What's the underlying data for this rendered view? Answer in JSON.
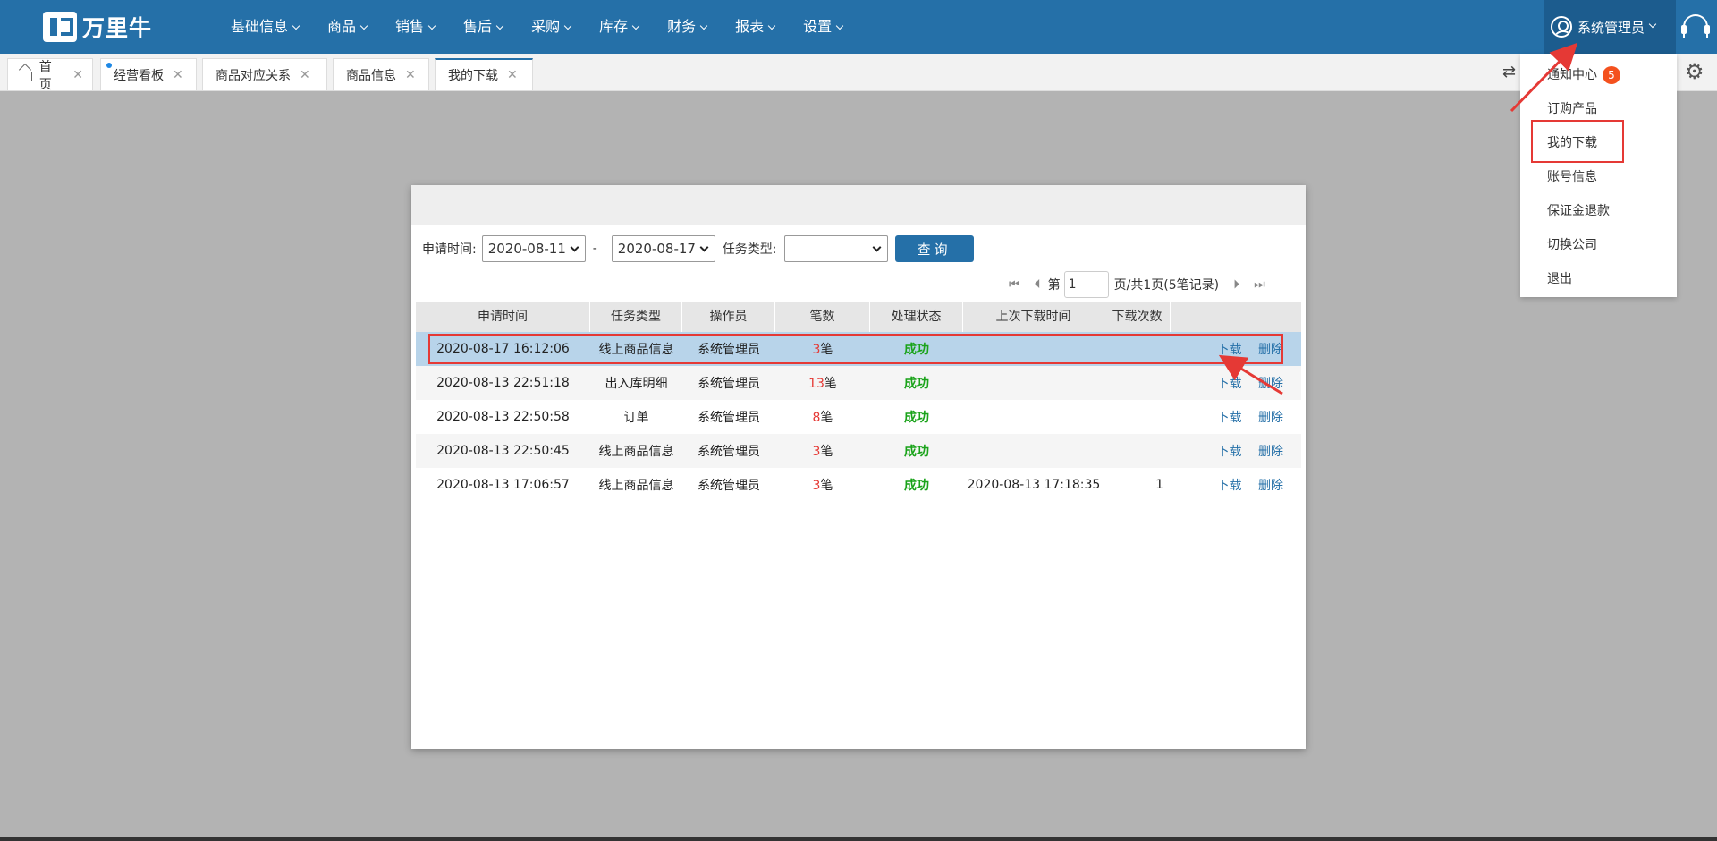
{
  "brand": {
    "name": "万里牛"
  },
  "nav": [
    "基础信息",
    "商品",
    "销售",
    "售后",
    "采购",
    "库存",
    "财务",
    "报表",
    "设置"
  ],
  "user": {
    "name": "系统管理员"
  },
  "tabs": [
    {
      "label": "首页"
    },
    {
      "label": "经营看板"
    },
    {
      "label": "商品对应关系"
    },
    {
      "label": "商品信息"
    },
    {
      "label": "我的下载"
    }
  ],
  "user_menu": {
    "items": [
      "通知中心",
      "订购产品",
      "我的下载",
      "账号信息",
      "保证金退款",
      "切换公司",
      "退出"
    ],
    "notify_count": "5"
  },
  "filters": {
    "apply_time_label": "申请时间:",
    "date_from": "2020-08-11",
    "separator": "-",
    "date_to": "2020-08-17",
    "task_type_label": "任务类型:",
    "task_type_value": "",
    "query_button": "查询"
  },
  "pager": {
    "prefix": "第",
    "page": "1",
    "suffix": "页/共1页(5笔记录)"
  },
  "table": {
    "columns": [
      "申请时间",
      "任务类型",
      "操作员",
      "笔数",
      "处理状态",
      "上次下载时间",
      "下载次数",
      ""
    ],
    "rows": [
      {
        "time": "2020-08-17 16:12:06",
        "type": "线上商品信息",
        "operator": "系统管理员",
        "count": "3",
        "unit": "笔",
        "status": "成功",
        "last": "",
        "times": "",
        "download": "下载",
        "delete": "删除"
      },
      {
        "time": "2020-08-13 22:51:18",
        "type": "出入库明细",
        "operator": "系统管理员",
        "count": "13",
        "unit": "笔",
        "status": "成功",
        "last": "",
        "times": "",
        "download": "下载",
        "delete": "删除"
      },
      {
        "time": "2020-08-13 22:50:58",
        "type": "订单",
        "operator": "系统管理员",
        "count": "8",
        "unit": "笔",
        "status": "成功",
        "last": "",
        "times": "",
        "download": "下载",
        "delete": "删除"
      },
      {
        "time": "2020-08-13 22:50:45",
        "type": "线上商品信息",
        "operator": "系统管理员",
        "count": "3",
        "unit": "笔",
        "status": "成功",
        "last": "",
        "times": "",
        "download": "下载",
        "delete": "删除"
      },
      {
        "time": "2020-08-13 17:06:57",
        "type": "线上商品信息",
        "operator": "系统管理员",
        "count": "3",
        "unit": "笔",
        "status": "成功",
        "last": "2020-08-13 17:18:35",
        "times": "1",
        "download": "下载",
        "delete": "删除"
      }
    ]
  },
  "colors": {
    "primary": "#2570a8",
    "annotation": "#e53935",
    "success": "#1aa31a"
  }
}
